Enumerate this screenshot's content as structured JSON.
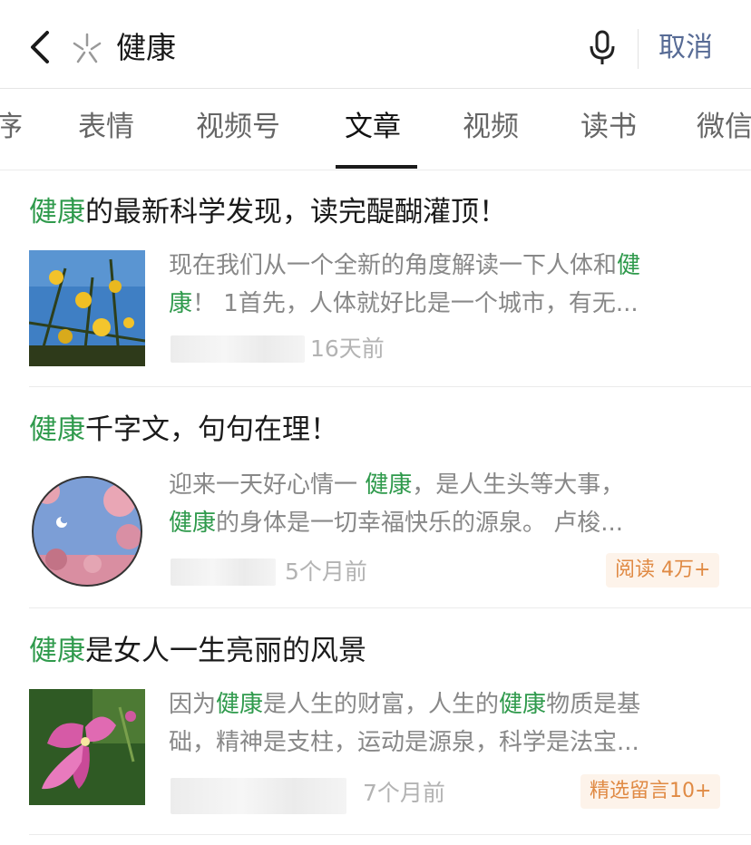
{
  "search": {
    "query": "健康",
    "cancel_label": "取消"
  },
  "tabs": [
    {
      "label": "序"
    },
    {
      "label": "表情"
    },
    {
      "label": "视频号"
    },
    {
      "label": "文章"
    },
    {
      "label": "视频"
    },
    {
      "label": "读书"
    },
    {
      "label": "微信"
    }
  ],
  "active_tab": "文章",
  "articles": [
    {
      "title_highlight": "健康",
      "title_rest": "的最新科学发现，读完醍醐灌顶！",
      "snippet_line1_a": "现在我们从一个全新的角度解读一下人体和",
      "snippet_line1_hl": "健",
      "snippet_line2_hl": "康",
      "snippet_line2_b": "！ 1首先，人体就好比是一个城市，有无...",
      "time": "16天前",
      "badge": ""
    },
    {
      "title_highlight": "健康",
      "title_rest": "千字文，句句在理！",
      "snippet_line1_a": "迎来一天好心情一 ",
      "snippet_line1_hl": "健康",
      "snippet_line1_b": "，是人生头等大事，",
      "snippet_line2_hl": "健康",
      "snippet_line2_b": "的身体是一切幸福快乐的源泉。 卢梭...",
      "time": "5个月前",
      "badge": "阅读 4万+"
    },
    {
      "title_highlight": "健康",
      "title_rest": "是女人一生亮丽的风景",
      "snippet_line1_a": "因为",
      "snippet_line1_hl": "健康",
      "snippet_line1_b": "是人生的财富，人生的",
      "snippet_line1_hl2": "健康",
      "snippet_line1_c": "物质是基",
      "snippet_line2_b": "础，精神是支柱，运动是源泉，科学是法宝...",
      "time": "7个月前",
      "badge": "精选留言10+"
    }
  ],
  "colors": {
    "highlight": "#2f9a4c",
    "cancel": "#576b95",
    "badge_text": "#e08a44",
    "badge_bg": "#fdf3ea"
  },
  "icons": [
    "back-arrow-icon",
    "search-sparkle-icon",
    "microphone-icon"
  ]
}
